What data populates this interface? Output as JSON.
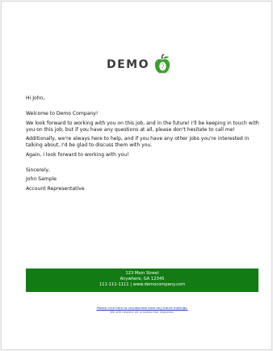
{
  "logo": {
    "text": "DEMO",
    "icon": "apple-icon",
    "icon_color": "#3aa02b"
  },
  "letter": {
    "greeting": "Hi John,",
    "welcome": "Welcome to Demo Company!",
    "paragraph1": "We look forward to working with you on this job, and in the future! I'll be keeping in touch with you on this job, but if you have any questions at all, please don't hesitate to call me!",
    "paragraph2": "Additionally, we're always here to help, and if you have any other jobs you're interested in talking about, I'd be glad to discuss them with you.",
    "paragraph3": "Again, I look forward to working with you!",
    "closing": "Sincerely,",
    "signer_name": "John Sample",
    "signer_title": "Account Representative"
  },
  "footer": {
    "background_color": "#137b13",
    "street": "123 Main Street",
    "city_line": "Anywhere, GA 12345",
    "contact_line": "111-111-1111 | www.democompany.com"
  },
  "unsubscribe": {
    "link_text": "Please click here to unsubscribe from any future mailings.",
    "note": "We will respect all unsubscribe requests."
  }
}
